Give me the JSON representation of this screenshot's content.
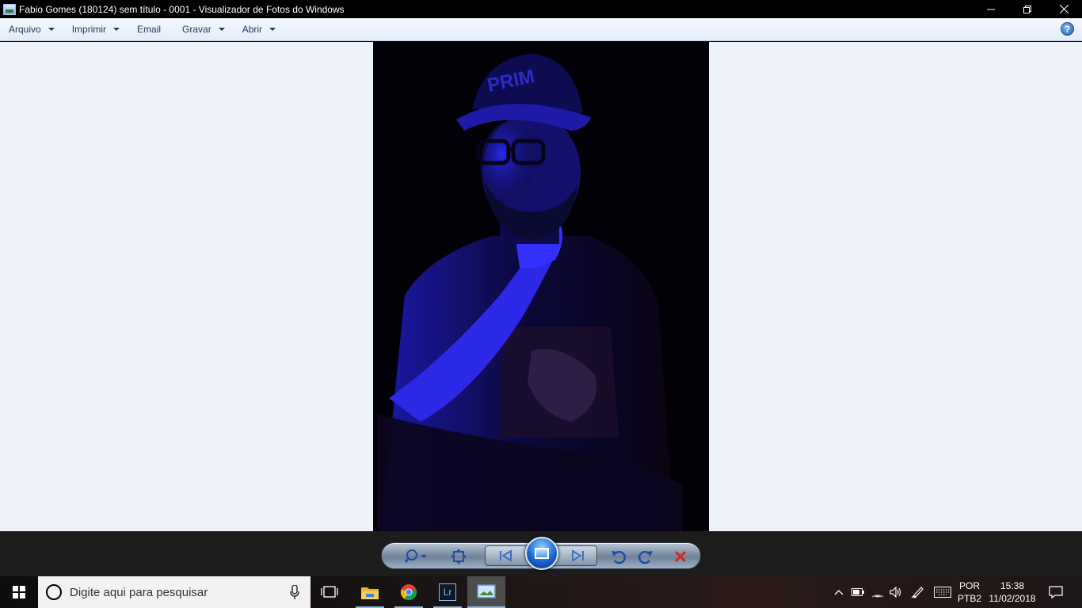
{
  "window": {
    "title": "Fabio Gomes (180124) sem título - 0001 - Visualizador de Fotos do Windows",
    "minimize_icon": "minimize-icon",
    "restore_icon": "restore-icon",
    "close_icon": "close-icon"
  },
  "menu": {
    "items": [
      {
        "label": "Arquivo",
        "has_dropdown": true
      },
      {
        "label": "Imprimir",
        "has_dropdown": true
      },
      {
        "label": "Email",
        "has_dropdown": false
      },
      {
        "label": "Gravar",
        "has_dropdown": true
      },
      {
        "label": "Abrir",
        "has_dropdown": true
      }
    ],
    "help_label": "?"
  },
  "controls": {
    "zoom": "zoom-icon",
    "actual_size": "actual-size-icon",
    "previous": "previous-icon",
    "slideshow": "slideshow-icon",
    "next": "next-icon",
    "rotate_left": "rotate-counterclockwise-icon",
    "rotate_right": "rotate-clockwise-icon",
    "delete": "delete-icon"
  },
  "taskbar": {
    "search_placeholder": "Digite aqui para pesquisar",
    "apps": [
      "task-view",
      "file-explorer",
      "chrome",
      "lightroom",
      "photo-viewer"
    ],
    "lightroom_label": "Lr",
    "language_line1": "POR",
    "language_line2": "PTB2",
    "time": "15:38",
    "date": "11/02/2018"
  },
  "colors": {
    "viewer_background": "#eef3fa",
    "photo_accent": "#1a1aff"
  }
}
